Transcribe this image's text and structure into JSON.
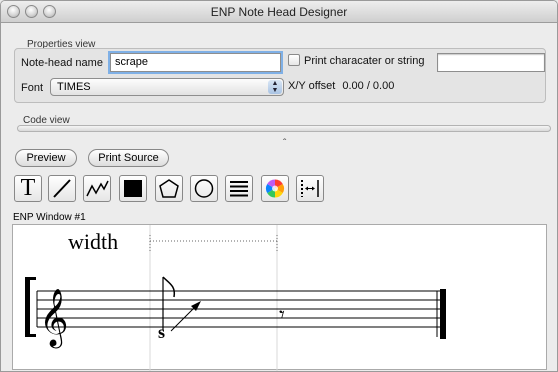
{
  "window": {
    "title": "ENP Note Head Designer"
  },
  "properties": {
    "group_title": "Properties view",
    "name_label": "Note-head name",
    "name_value": "scrape",
    "font_label": "Font",
    "font_value": "TIMES",
    "print_checkbox_label": "Print characater or string",
    "print_checkbox_checked": false,
    "string_value": "",
    "offset_label": "X/Y offset",
    "offset_value": "0.00 / 0.00"
  },
  "code_view": {
    "title": "Code view",
    "split_arrow": "ˆ"
  },
  "buttons": {
    "preview": "Preview",
    "print_source": "Print Source"
  },
  "tools": [
    {
      "name": "text-tool",
      "icon": "text-T-icon",
      "glyph": "T"
    },
    {
      "name": "line-tool",
      "icon": "line-icon"
    },
    {
      "name": "polyline-tool",
      "icon": "zigzag-icon"
    },
    {
      "name": "filled-rect-tool",
      "icon": "filled-square-icon"
    },
    {
      "name": "polygon-tool",
      "icon": "pentagon-icon"
    },
    {
      "name": "circle-tool",
      "icon": "circle-icon"
    },
    {
      "name": "lines-tool",
      "icon": "horizontal-lines-icon"
    },
    {
      "name": "color-tool",
      "icon": "color-wheel-icon"
    },
    {
      "name": "spacing-tool",
      "icon": "spacing-icon"
    }
  ],
  "enp": {
    "window_label": "ENP Window #1",
    "width_label": "width",
    "notehead_glyph": "s"
  },
  "colors": {
    "accent_focus": "#7fb0e6"
  }
}
